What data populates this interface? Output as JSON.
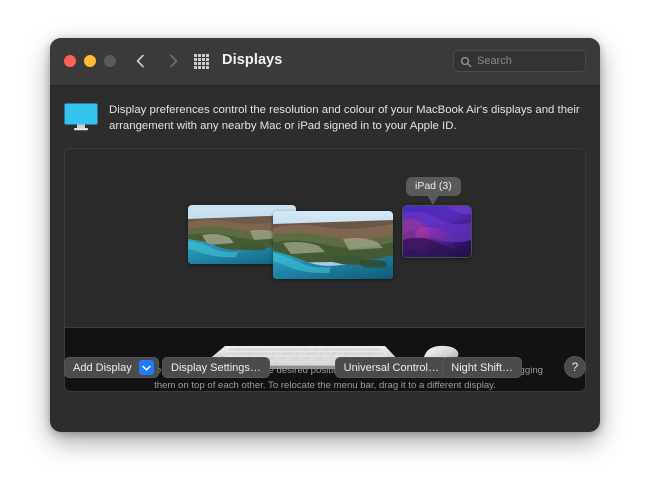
{
  "window": {
    "title": "Displays",
    "traffic_lights": [
      {
        "name": "close",
        "color": "#ff5f57"
      },
      {
        "name": "minimize",
        "color": "#febc2e"
      },
      {
        "name": "zoom",
        "color": "#5b5b5b"
      }
    ],
    "nav": {
      "back_label": "Back",
      "forward_label": "Forward",
      "grid_label": "Show All"
    }
  },
  "search": {
    "placeholder": "Search",
    "value": ""
  },
  "blurb": {
    "text": "Display preferences control the resolution and colour of your MacBook Air's displays and their arrangement with any nearby Mac or iPad signed in to your Apple ID."
  },
  "arrangement": {
    "tooltip_label": "iPad (3)",
    "displays": [
      {
        "name": "display-1",
        "type": "mac",
        "wallpaper": "coast"
      },
      {
        "name": "display-2",
        "type": "mac",
        "wallpaper": "coast"
      },
      {
        "name": "display-3",
        "type": "ipad",
        "wallpaper": "monterey-purple"
      }
    ],
    "peripherals": [
      "magic-keyboard",
      "magic-mouse"
    ],
    "hint_line_1": "To rearrange displays, drag them to the desired position. To mirror displays, hold Option while dragging",
    "hint_line_2": "them on top of each other. To relocate the menu bar, drag it to a different display."
  },
  "footer": {
    "add_display": "Add Display",
    "display_settings": "Display Settings…",
    "universal_control": "Universal Control…",
    "night_shift": "Night Shift…",
    "help": "?"
  },
  "colors": {
    "window_body": "#2d2d2d",
    "titlebar": "#3a3a3a",
    "canvas": "#2a2a2a",
    "accent_blue": "#207aff",
    "monitor_icon": "#35c3f0",
    "tooltip_bg": "#5a5a5a"
  }
}
